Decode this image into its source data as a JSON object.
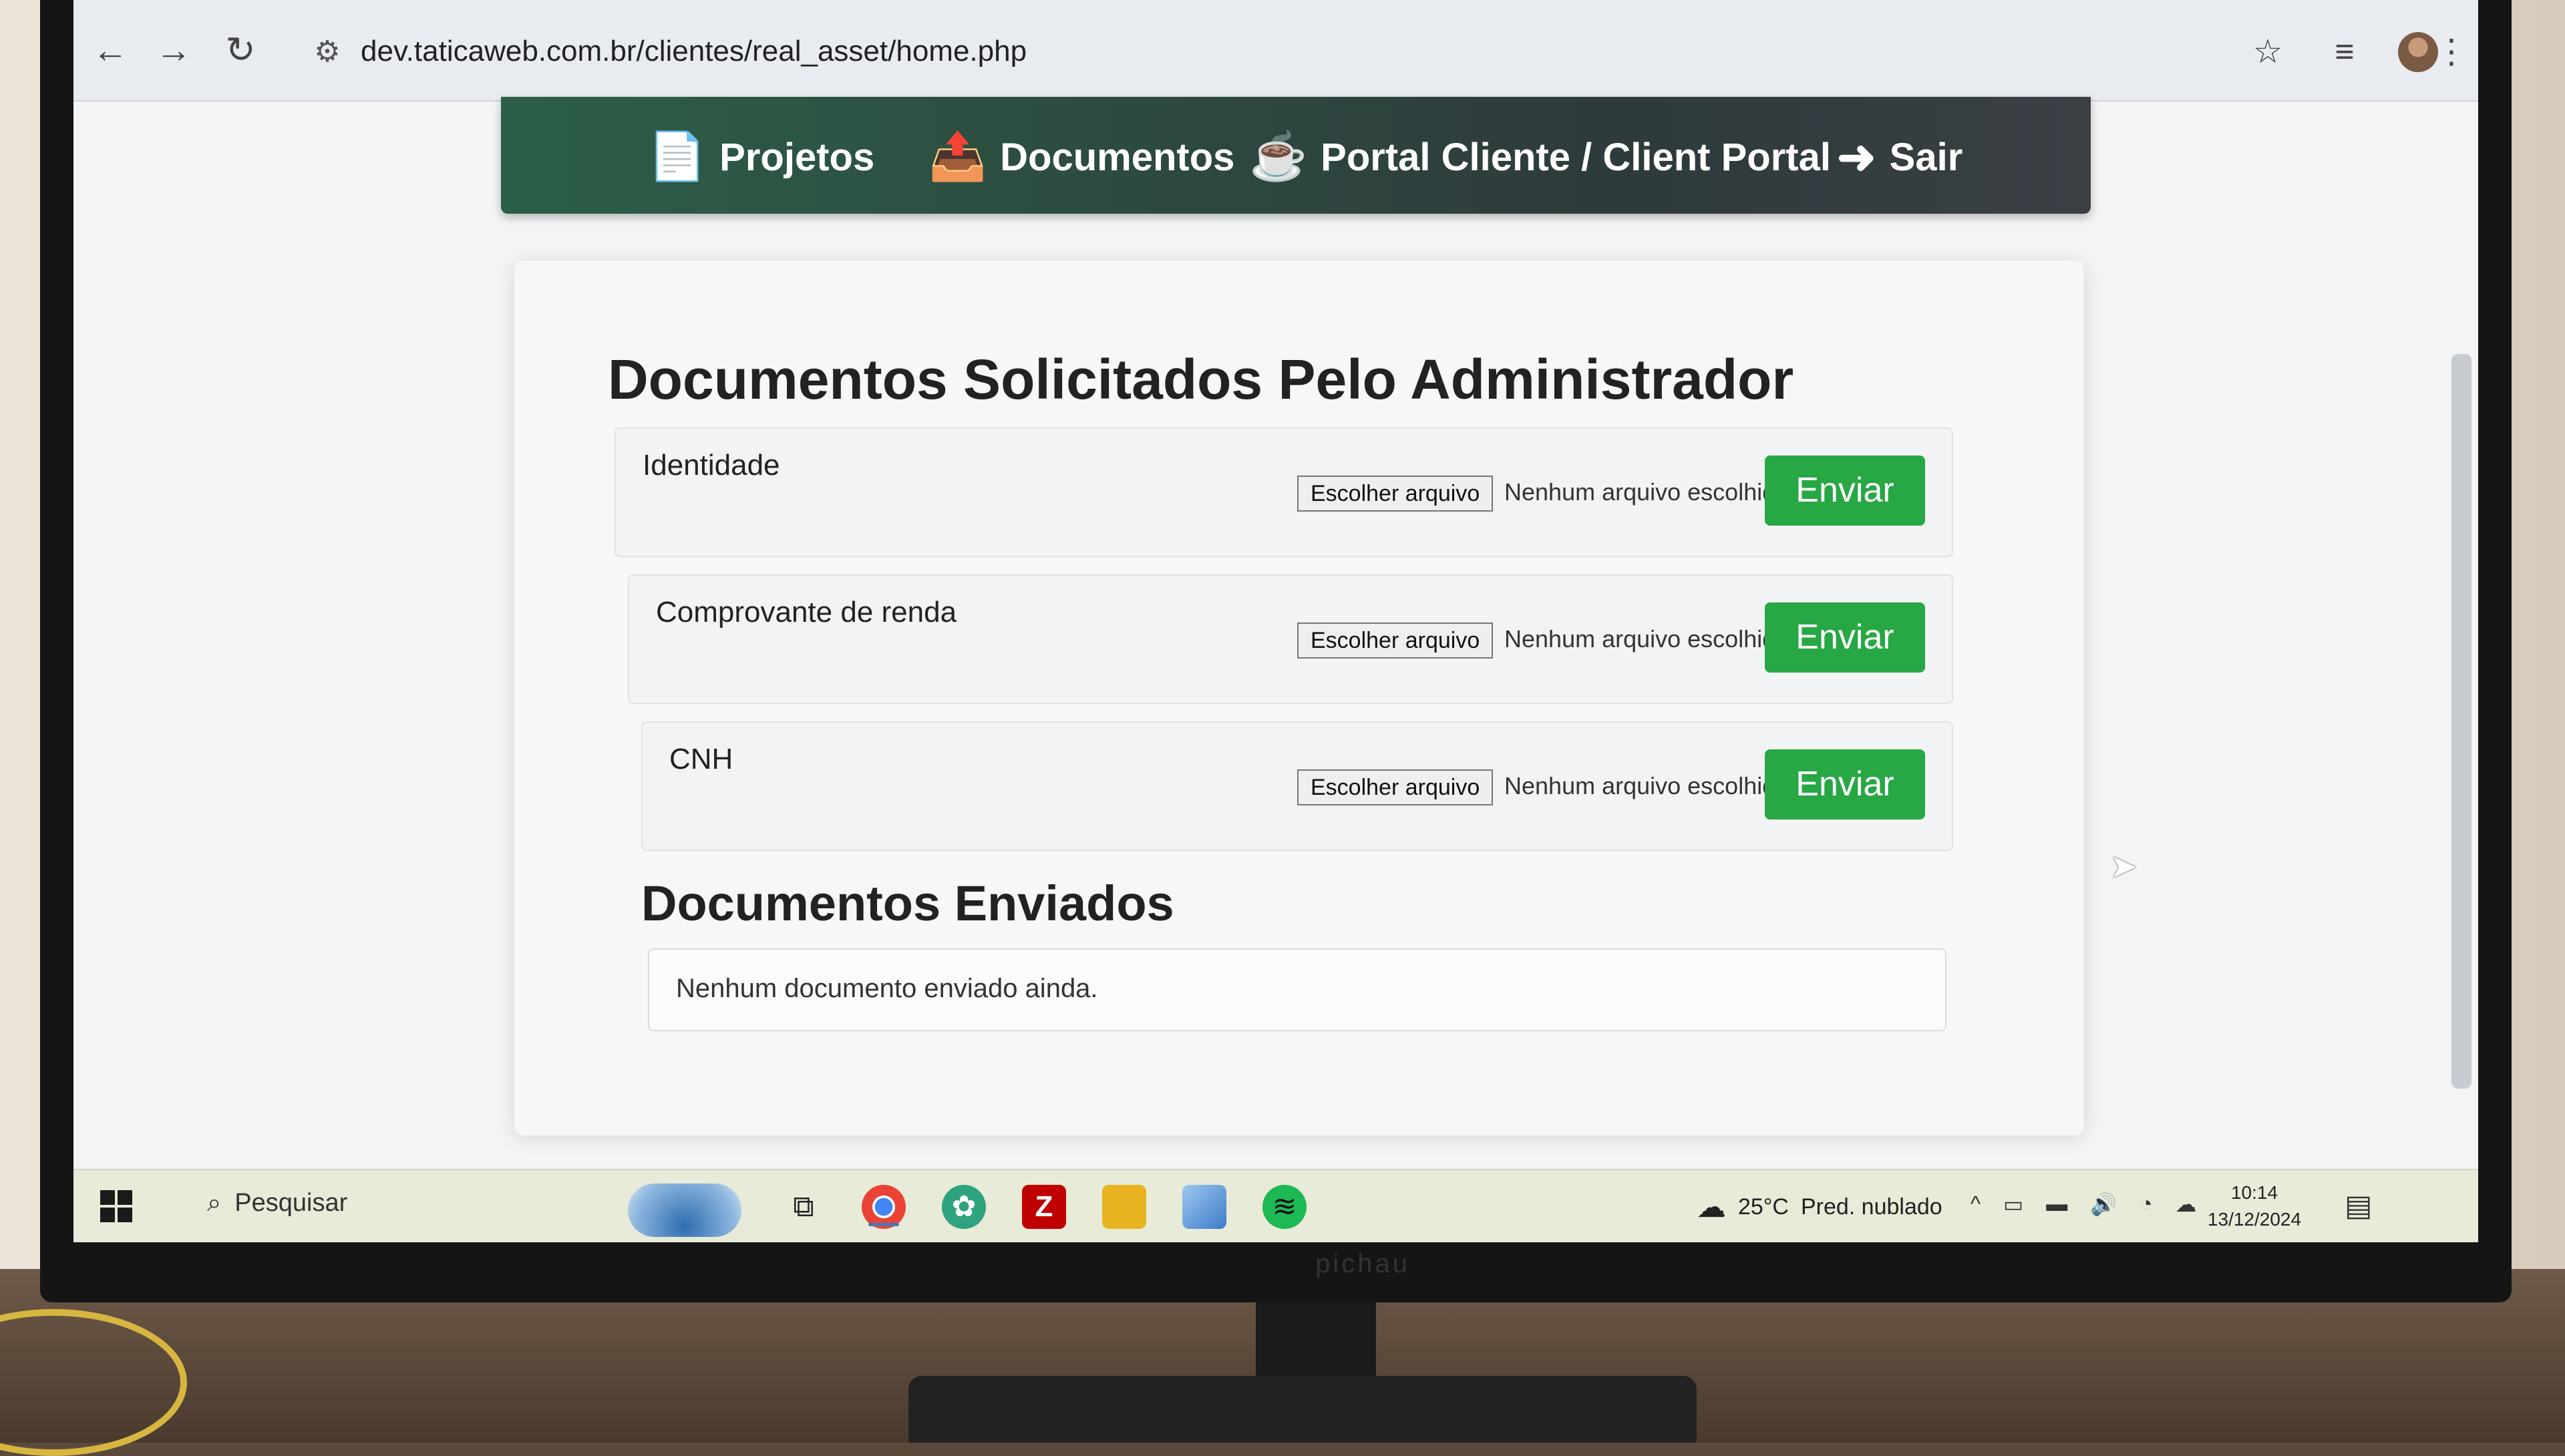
{
  "browser": {
    "url": "dev.taticaweb.com.br/clientes/real_asset/home.php",
    "back_icon": "←",
    "forward_icon": "→",
    "reload_icon": "↻",
    "site_info_icon": "⚙",
    "bookmark_icon": "☆",
    "media_icon": "≡",
    "menu_icon": "⋮"
  },
  "nav": {
    "items": [
      {
        "label": "Projetos",
        "icon": "📄"
      },
      {
        "label": "Documentos",
        "icon": "📤"
      },
      {
        "label": "Portal Cliente / Client Portal",
        "icon": "☕"
      },
      {
        "label": "Sair",
        "icon": "➜"
      }
    ]
  },
  "requested": {
    "title": "Documentos Solicitados Pelo Administrador",
    "rows": [
      {
        "name": "Identidade",
        "file_button": "Escolher arquivo",
        "file_status": "Nenhum arquivo escolhido",
        "send": "Enviar"
      },
      {
        "name": "Comprovante de renda",
        "file_button": "Escolher arquivo",
        "file_status": "Nenhum arquivo escolhido",
        "send": "Enviar"
      },
      {
        "name": "CNH",
        "file_button": "Escolher arquivo",
        "file_status": "Nenhum arquivo escolhido",
        "send": "Enviar"
      }
    ]
  },
  "sent": {
    "title": "Documentos Enviados",
    "empty_message": "Nenhum documento enviado ainda."
  },
  "taskbar": {
    "search_label": "Pesquisar",
    "search_icon": "⌕",
    "weather_temp": "25°C",
    "weather_desc": "Pred. nublado",
    "time": "10:14",
    "date": "13/12/2024",
    "apps": [
      "task-view",
      "chrome",
      "chatgpt",
      "filezilla",
      "file-explorer",
      "app",
      "spotify"
    ]
  },
  "monitor": {
    "brand": "pichau"
  }
}
